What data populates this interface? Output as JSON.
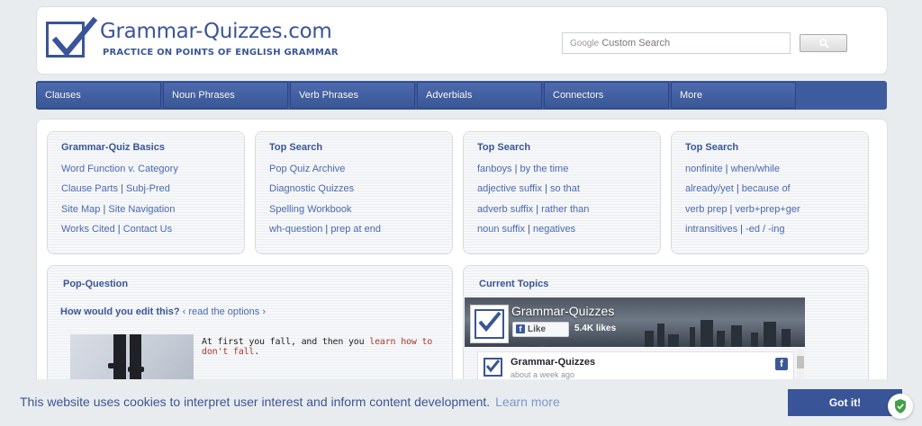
{
  "header": {
    "brand": "Grammar-Quizzes.com",
    "tagline": "PRACTICE ON POINTS OF ENGLISH GRAMMAR",
    "search_prefix": "Google",
    "search_placeholder": "Custom Search"
  },
  "nav": {
    "items": [
      {
        "label": "Clauses"
      },
      {
        "label": "Noun Phrases"
      },
      {
        "label": "Verb Phrases"
      },
      {
        "label": "Adverbials"
      },
      {
        "label": "Connectors"
      },
      {
        "label": "More"
      }
    ]
  },
  "cards": [
    {
      "title": "Grammar-Quiz Basics",
      "lines": [
        [
          "Word Function v. Category"
        ],
        [
          "Clause Parts",
          "Subj-Pred"
        ],
        [
          "Site Map",
          "Site Navigation"
        ],
        [
          "Works Cited",
          "Contact Us"
        ]
      ]
    },
    {
      "title": "Top Search",
      "lines": [
        [
          "Pop Quiz Archive"
        ],
        [
          "Diagnostic Quizzes"
        ],
        [
          "Spelling Workbook"
        ],
        [
          "wh-question",
          "prep at end"
        ]
      ]
    },
    {
      "title": "Top Search",
      "lines": [
        [
          "fanboys",
          "by the time"
        ],
        [
          "adjective suffix",
          "so that"
        ],
        [
          "adverb suffix",
          "rather than"
        ],
        [
          "noun suffix",
          "negatives"
        ]
      ]
    },
    {
      "title": "Top Search",
      "lines": [
        [
          "nonfinite",
          "when/while"
        ],
        [
          "already/yet",
          "because of"
        ],
        [
          "verb prep",
          "verb+prep+ger"
        ],
        [
          "intransitives",
          "-ed / -ing"
        ]
      ]
    }
  ],
  "separator": "|",
  "pop_question": {
    "title": "Pop-Question",
    "question": "How would you edit this?",
    "read_link": "‹ read the options ›",
    "text_before": "At first you fall, and then you ",
    "text_link": "learn how to don't fall",
    "text_after": "."
  },
  "current_topics": {
    "title": "Current Topics",
    "fb_page_name": "Grammar-Quizzes",
    "fb_like_label": "Like Page",
    "fb_likes": "5.4K likes",
    "post_name": "Grammar-Quizzes",
    "post_time": "about a week ago"
  },
  "cookie": {
    "message": "This website uses cookies to interpret user interest and inform content development.",
    "learn_more": "Learn more",
    "button": "Got it!"
  },
  "colors": {
    "brand": "#3a5597",
    "link": "#4a69b0",
    "accent_red": "#a3392c",
    "facebook": "#3b5998"
  }
}
